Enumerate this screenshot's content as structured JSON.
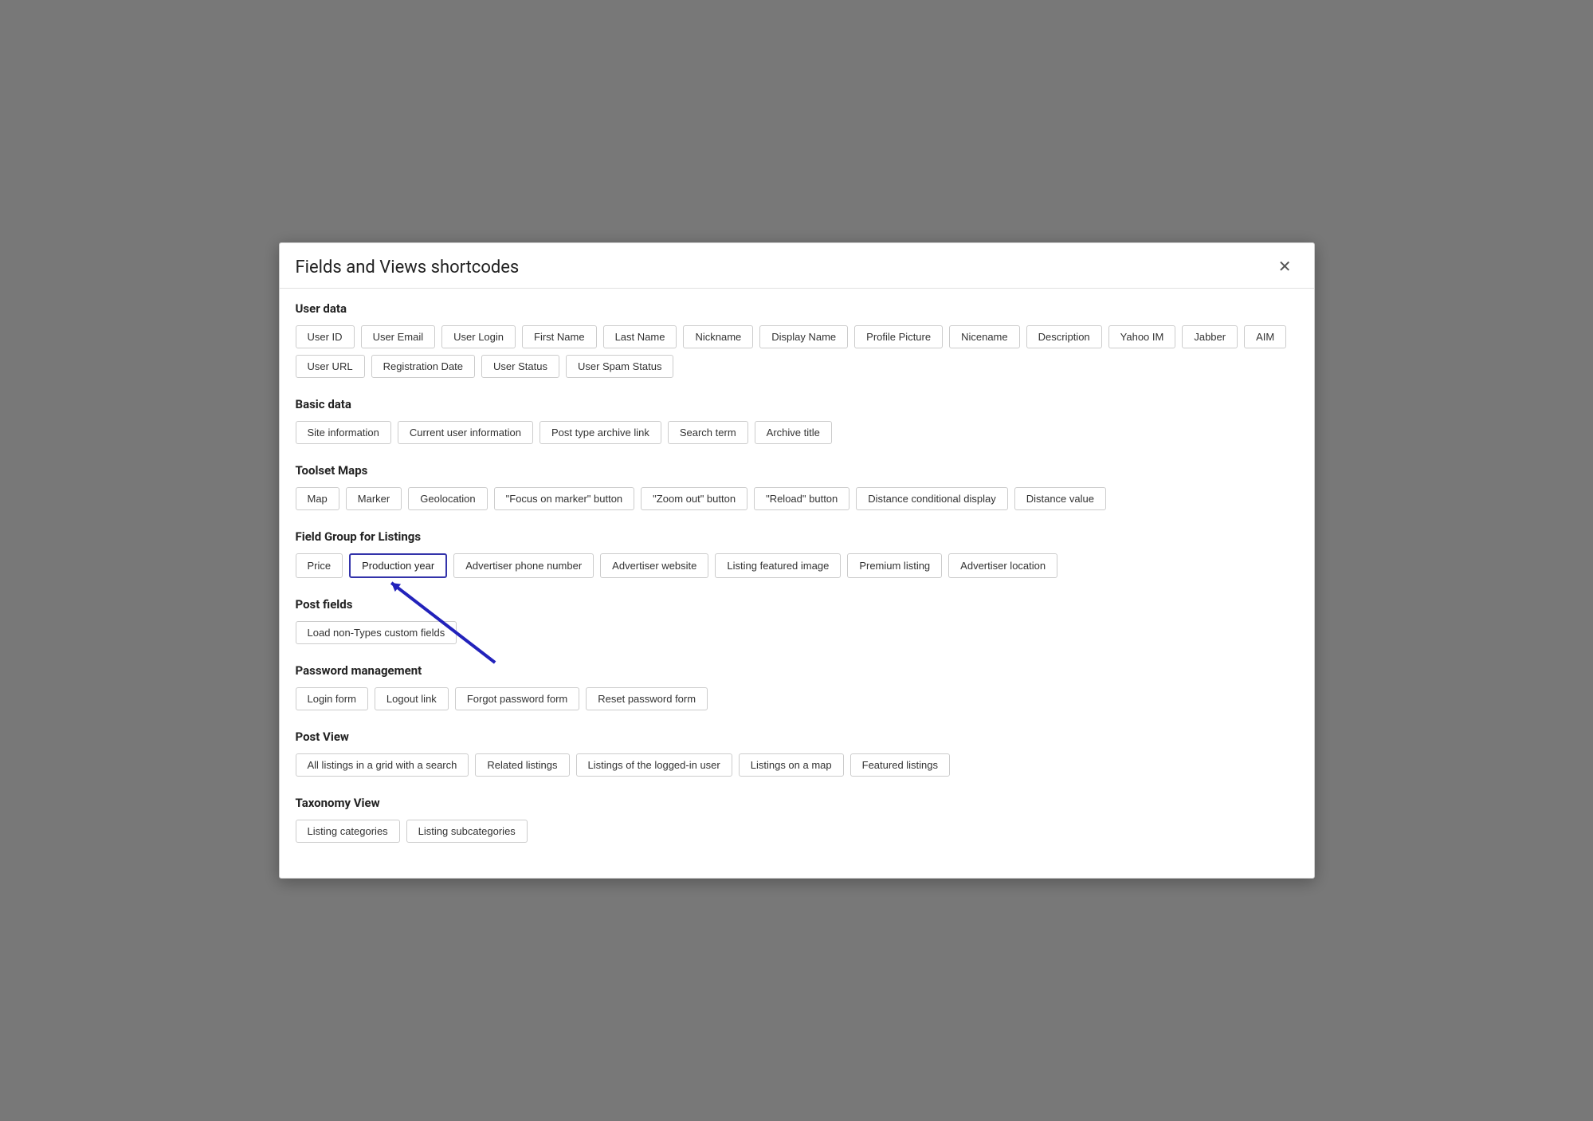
{
  "modal": {
    "title": "Fields and Views shortcodes",
    "close_label": "✕"
  },
  "sections": [
    {
      "id": "user-data",
      "title": "User data",
      "buttons": [
        "User ID",
        "User Email",
        "User Login",
        "First Name",
        "Last Name",
        "Nickname",
        "Display Name",
        "Profile Picture",
        "Nicename",
        "Description",
        "Yahoo IM",
        "Jabber",
        "AIM",
        "User URL",
        "Registration Date",
        "User Status",
        "User Spam Status"
      ]
    },
    {
      "id": "basic-data",
      "title": "Basic data",
      "buttons": [
        "Site information",
        "Current user information",
        "Post type archive link",
        "Search term",
        "Archive title"
      ]
    },
    {
      "id": "toolset-maps",
      "title": "Toolset Maps",
      "buttons": [
        "Map",
        "Marker",
        "Geolocation",
        "\"Focus on marker\" button",
        "\"Zoom out\" button",
        "\"Reload\" button",
        "Distance conditional display",
        "Distance value"
      ]
    },
    {
      "id": "field-group-listings",
      "title": "Field Group for Listings",
      "buttons": [
        "Price",
        "Production year",
        "Advertiser phone number",
        "Advertiser website",
        "Listing featured image",
        "Premium listing",
        "Advertiser location"
      ],
      "highlighted": "Production year"
    },
    {
      "id": "post-fields",
      "title": "Post fields",
      "buttons": [
        "Load non-Types custom fields"
      ]
    },
    {
      "id": "password-management",
      "title": "Password management",
      "buttons": [
        "Login form",
        "Logout link",
        "Forgot password form",
        "Reset password form"
      ]
    },
    {
      "id": "post-view",
      "title": "Post View",
      "buttons": [
        "All listings in a grid with a search",
        "Related listings",
        "Listings of the logged-in user",
        "Listings on a map",
        "Featured listings"
      ]
    },
    {
      "id": "taxonomy-view",
      "title": "Taxonomy View",
      "buttons": [
        "Listing categories",
        "Listing subcategories"
      ]
    }
  ]
}
